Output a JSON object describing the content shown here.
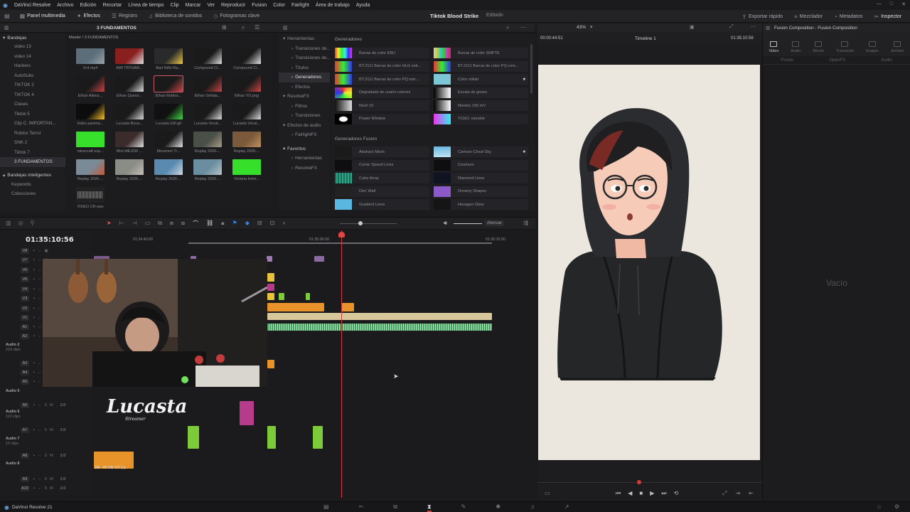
{
  "app": {
    "name": "DaVinci Resolve",
    "footer": "DaVinci Resolve 21"
  },
  "menu": [
    "Archivo",
    "Edición",
    "Recortar",
    "Línea de tiempo",
    "Clip",
    "Marcar",
    "Ver",
    "Reproducir",
    "Fusion",
    "Color",
    "Fairlight",
    "Área de trabajo",
    "Ayuda"
  ],
  "toolbar": {
    "left": [
      "Panel multimedia",
      "Efectos",
      "Registro",
      "Biblioteca de sonidos",
      "Fotogramas clave"
    ],
    "project_title": "Tiktok Blood Strike",
    "project_status": "Editado",
    "right": [
      "Exportar rápido",
      "Mezclador",
      "Metadatos",
      "Inspector"
    ]
  },
  "bins": {
    "header": "Bandejas",
    "items": [
      "video 13",
      "video 14",
      "Hackers",
      "AutoSubs",
      "TIKTOK 2",
      "TIKTOK 4",
      "Clases",
      "Tiktok 5",
      "Clip C. IMPORTAN...",
      "Roblox Terror",
      "SNK 2",
      "Tiktok 7",
      "3 FUNDAMENTOS"
    ],
    "smart_header": "Bandejas inteligentes",
    "smart_items": [
      "Keywords",
      "Colecciones"
    ]
  },
  "media": {
    "folder": "3 FUNDAMENTOS",
    "path": "Master / 3 FUNDAMENTOS",
    "clips": [
      "2v4.mp4",
      "AIM TRYHAR...",
      "Bart Niño Ra...",
      "Compound Cl...",
      "Compound Cl...",
      "Ethan Alienz...",
      "Ethan Queso...",
      "Ethan Roblox...",
      "Ethan Señala...",
      "Ethan YO.png",
      "Index pavima...",
      "Lucasta Boca...",
      "Lucasta GIF.gif",
      "Lucasta Vocal...",
      "Lucasta Vocal...",
      "minecraft esp...",
      "Mini MEJOR ...",
      "Movemnt Tr...",
      "Replay 2026-...",
      "Replay 2026-...",
      "Replay 2026-...",
      "Replay 2026-...",
      "Replay 2026-...",
      "Replay 2026-...",
      "Victoria fortni...",
      "VIDEO CR.wav"
    ]
  },
  "fx_categories": {
    "items": [
      "Herramientas",
      "Transiciones de...",
      "Transiciones de...",
      "Títulos",
      "Generadores",
      "Efectos",
      "ResolveFX",
      "Filtros",
      "Transiciones",
      "Efectos de audio",
      "FairlightFX"
    ],
    "favorites_header": "Favoritos",
    "favorites": [
      "Herramientas",
      "ResolveFX"
    ]
  },
  "generators": {
    "section1": "Generadores",
    "items1": [
      "Barras de color EBU",
      "Barras de color SMPTE",
      "BT.2111 Barras de color HLG estr...",
      "BT.2111 Barras de color PQ com...",
      "BT.2111 Barras de color PQ estr...",
      "Color sólido",
      "Degradado de cuatro colores",
      "Escala de grises",
      "Nivel 10",
      "Niveles 100 mV",
      "Power Window",
      "YCbCr variable"
    ],
    "section2": "Generadores Fusion",
    "items2": [
      "Abstract Mesh",
      "Cartoon Cloud Sky",
      "Comic Speed Lines",
      "Contours",
      "Cube Array",
      "Diamond Lines",
      "Disc Wall",
      "Dreamy Shapes",
      "Gradient Lines",
      "Hexagon Glow"
    ]
  },
  "viewer": {
    "zoom": "43%",
    "timecode_left": "00:00:44:51",
    "timeline_name": "Timeline 1",
    "timecode_right": "01:35:10:56"
  },
  "inspector": {
    "title": "Fusion Composition - Fusion Composition",
    "tabs": [
      "Video",
      "Audio",
      "Efecto",
      "Transición",
      "Imagen",
      "Archivo"
    ],
    "subtabs": [
      "Fusion",
      "OpenFX",
      "Audio"
    ],
    "empty": "Vacío"
  },
  "timeline": {
    "timecode": "01:35:10:56",
    "ruler": [
      "01:34:40:00",
      "01:35:06:00",
      "01:35:32:00"
    ],
    "audio_label": "Atenuar",
    "video_tracks": [
      "V8",
      "V7",
      "V6",
      "V5",
      "V4",
      "V3",
      "V2",
      "V1"
    ],
    "audio_tracks": [
      "A1",
      "A2",
      "A3",
      "A4",
      "A5",
      "A6",
      "A7",
      "A8",
      "A9",
      "A10"
    ],
    "audio_groups": [
      {
        "name": "Audio 2",
        "sub": "219 clips"
      },
      {
        "name": "Audio 5",
        "sub": ""
      },
      {
        "name": "Audio 6",
        "sub": "113 clips"
      },
      {
        "name": "Audio 7",
        "sub": "13 clips"
      },
      {
        "name": "Audio 8",
        "sub": ""
      }
    ],
    "gain": "2.0",
    "clip_label": "JIA - WI ON GO (Ly..."
  },
  "overlay": {
    "logo_text": "Lucasta",
    "logo_sub": "Streamer"
  },
  "colors": {
    "accent": "#d63b3b",
    "audio_clip": "#3fa15c",
    "orange_clip": "#e8922a",
    "green_clip": "#7ccc3a",
    "pink_clip": "#b63c8b",
    "tan_clip": "#d8c79a"
  }
}
